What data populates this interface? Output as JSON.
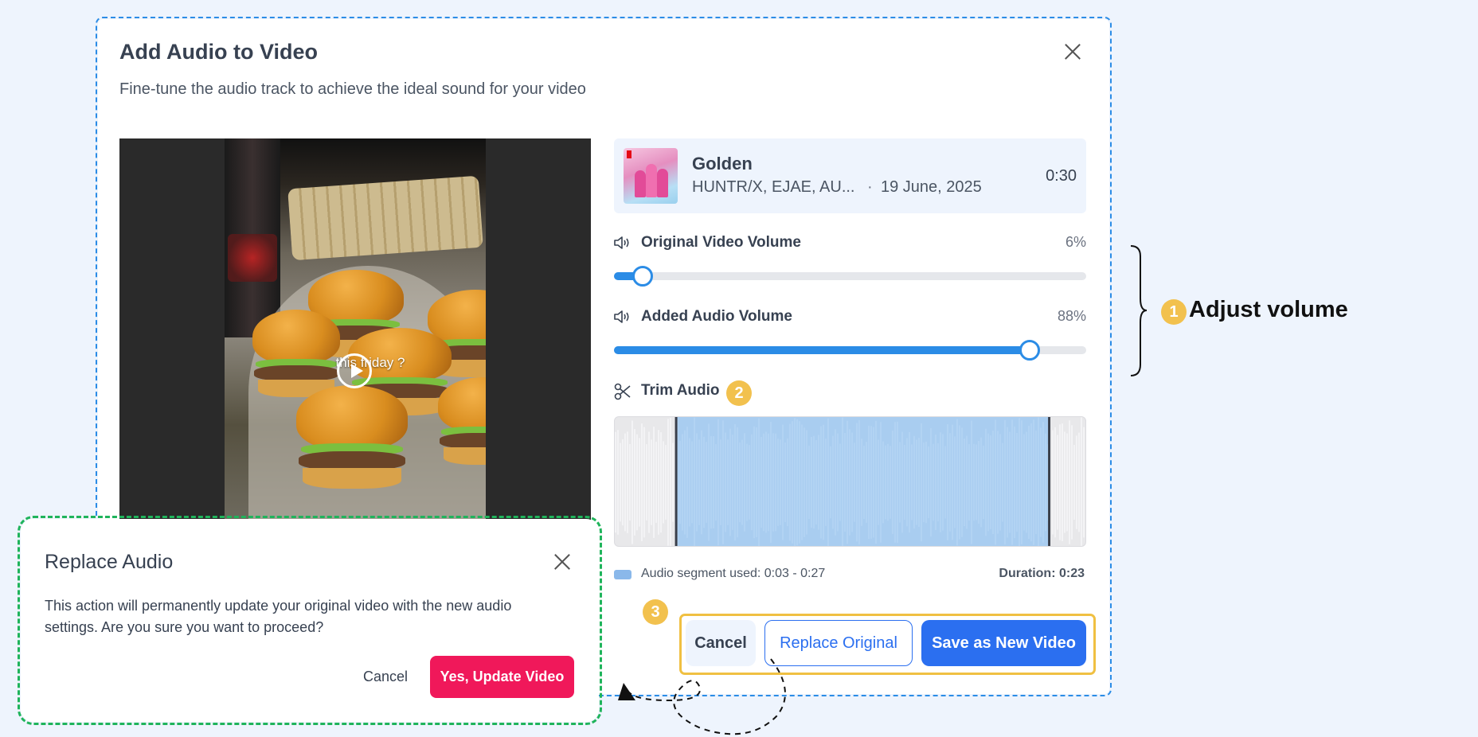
{
  "main_modal": {
    "title": "Add Audio to Video",
    "subtitle": "Fine-tune the audio track to achieve the ideal sound for your video",
    "close_icon": "close-icon"
  },
  "video": {
    "caption": "this friday ?",
    "play_icon": "play-circle-icon"
  },
  "track": {
    "title": "Golden",
    "artists": "HUNTR/X, EJAE, AU...",
    "separator": "·",
    "date": "19 June, 2025",
    "duration": "0:30"
  },
  "volume": {
    "original": {
      "label": "Original Video Volume",
      "value_text": "6%",
      "value": 0.06,
      "icon": "speaker-icon"
    },
    "added": {
      "label": "Added Audio Volume",
      "value_text": "88%",
      "value": 0.88,
      "icon": "speaker-icon"
    }
  },
  "trim": {
    "label": "Trim Audio",
    "icon": "scissors-icon",
    "segment_text": "Audio segment used: 0:03 - 0:27",
    "duration_text": "Duration: 0:23",
    "selection_start": 0.13,
    "selection_end": 0.92
  },
  "actions": {
    "cancel": "Cancel",
    "replace": "Replace Original",
    "save": "Save as New Video"
  },
  "annotations": {
    "badge_1": "1",
    "badge_2": "2",
    "badge_3": "3",
    "adjust_volume": "Adjust volume"
  },
  "confirm": {
    "title": "Replace Audio",
    "body": "This action will permanently update your original video with the new audio settings. Are you sure you want to proceed?",
    "cancel": "Cancel",
    "confirm": "Yes, Update Video"
  },
  "colors": {
    "accent_blue": "#2b8ce6",
    "primary_button": "#2b6ff0",
    "danger_button": "#f0185a",
    "badge_yellow": "#f2c14e",
    "confirm_frame_green": "#1fb45b"
  }
}
